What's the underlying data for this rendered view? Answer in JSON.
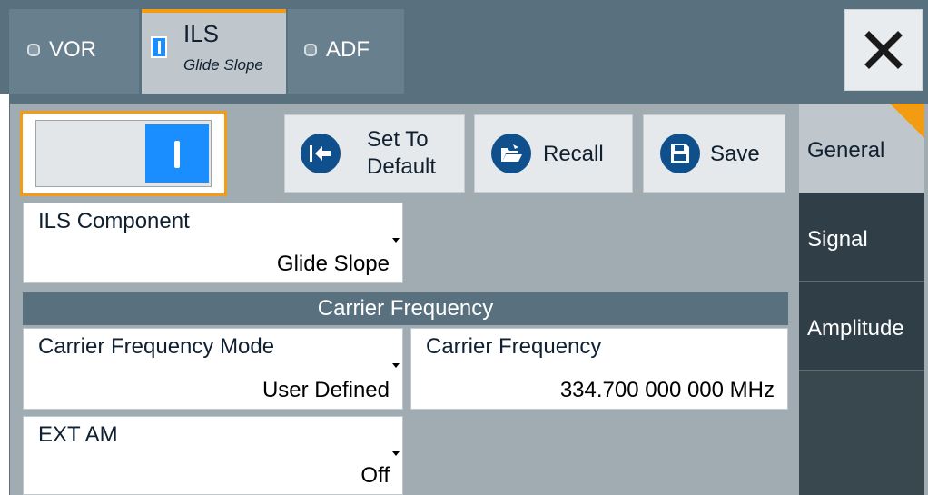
{
  "tabs": [
    {
      "label": "VOR",
      "active": false
    },
    {
      "label": "ILS",
      "sublabel": "Glide Slope",
      "active": true
    },
    {
      "label": "ADF",
      "active": false
    }
  ],
  "close_icon": "close-x-icon",
  "toggle": {
    "state": "on"
  },
  "buttons": {
    "set_default": {
      "line1": "Set To",
      "line2": "Default",
      "icon": "set-default-icon"
    },
    "recall": {
      "label": "Recall",
      "icon": "folder-open-icon"
    },
    "save": {
      "label": "Save",
      "icon": "save-disk-icon"
    }
  },
  "side_tabs": [
    "General",
    "Signal",
    "Amplitude"
  ],
  "ils_component": {
    "title": "ILS Component",
    "value": "Glide Slope"
  },
  "carrier_section": {
    "title": "Carrier Frequency"
  },
  "carrier_mode": {
    "title": "Carrier Frequency Mode",
    "value": "User Defined"
  },
  "carrier_freq": {
    "title": "Carrier Frequency",
    "value": "334.700 000 000 MHz"
  },
  "ext_am": {
    "title": "EXT AM",
    "value": "Off"
  },
  "colors": {
    "accent": "#f39c12",
    "active_blue": "#1a8dff",
    "header": "#59707f",
    "icon_blue": "#0e4f8c"
  }
}
